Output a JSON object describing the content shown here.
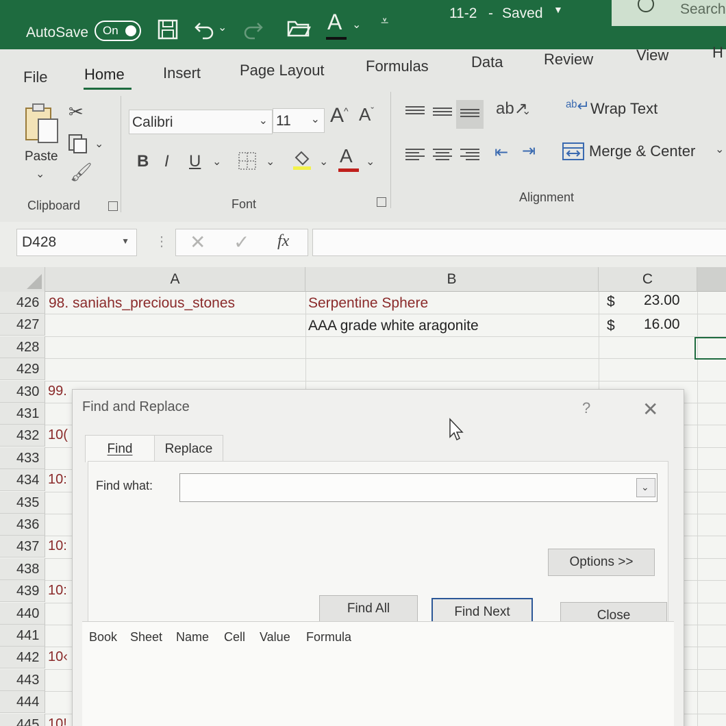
{
  "titlebar": {
    "autosave_label": "AutoSave",
    "toggle_label": "On",
    "document_title": "11-2",
    "saved_status": "Saved",
    "title_separator": "-",
    "search_placeholder": "Search"
  },
  "ribbon": {
    "tabs": [
      "File",
      "Home",
      "Insert",
      "Page Layout",
      "Formulas",
      "Data",
      "Review",
      "View",
      "H"
    ],
    "active_tab": "Home",
    "clipboard": {
      "paste_label": "Paste",
      "group_label": "Clipboard"
    },
    "font": {
      "font_name": "Calibri",
      "font_size": "11",
      "bold": "B",
      "italic": "I",
      "underline": "U",
      "font_color_glyph": "A",
      "group_label": "Font",
      "grow": "A",
      "shrink": "A"
    },
    "alignment": {
      "wrap_text": "Wrap Text",
      "merge_center": "Merge & Center",
      "group_label": "Alignment"
    }
  },
  "formula_bar": {
    "name_box": "D428",
    "fx": "fx",
    "content": ""
  },
  "grid": {
    "columns": [
      "A",
      "B",
      "C"
    ],
    "rows": [
      {
        "num": "426",
        "a": "98. saniahs_precious_stones",
        "b": "Serpentine Sphere",
        "c_currency": "$",
        "c_value": "23.00"
      },
      {
        "num": "427",
        "a": "",
        "b": "AAA grade white aragonite",
        "c_currency": "$",
        "c_value": "16.00"
      },
      {
        "num": "428",
        "a": ""
      },
      {
        "num": "429",
        "a": ""
      },
      {
        "num": "430",
        "a": "99."
      },
      {
        "num": "431",
        "a": ""
      },
      {
        "num": "432",
        "a": "10("
      },
      {
        "num": "433",
        "a": ""
      },
      {
        "num": "434",
        "a": "10:"
      },
      {
        "num": "435",
        "a": ""
      },
      {
        "num": "436",
        "a": ""
      },
      {
        "num": "437",
        "a": "10:"
      },
      {
        "num": "438",
        "a": ""
      },
      {
        "num": "439",
        "a": "10:"
      },
      {
        "num": "440",
        "a": ""
      },
      {
        "num": "441",
        "a": ""
      },
      {
        "num": "442",
        "a": "10‹"
      },
      {
        "num": "443",
        "a": ""
      },
      {
        "num": "444",
        "a": ""
      },
      {
        "num": "445",
        "a": "10!"
      }
    ]
  },
  "dialog": {
    "title": "Find and Replace",
    "help": "?",
    "tabs": [
      "Find",
      "Replace"
    ],
    "active_tab": "Find",
    "find_what_label": "Find what:",
    "find_what_value": "",
    "options_button": "Options >>",
    "find_all_button": "Find All",
    "find_next_button": "Find Next",
    "close_button": "Close",
    "result_columns": [
      "Book",
      "Sheet",
      "Name",
      "Cell",
      "Value",
      "Formula"
    ]
  }
}
